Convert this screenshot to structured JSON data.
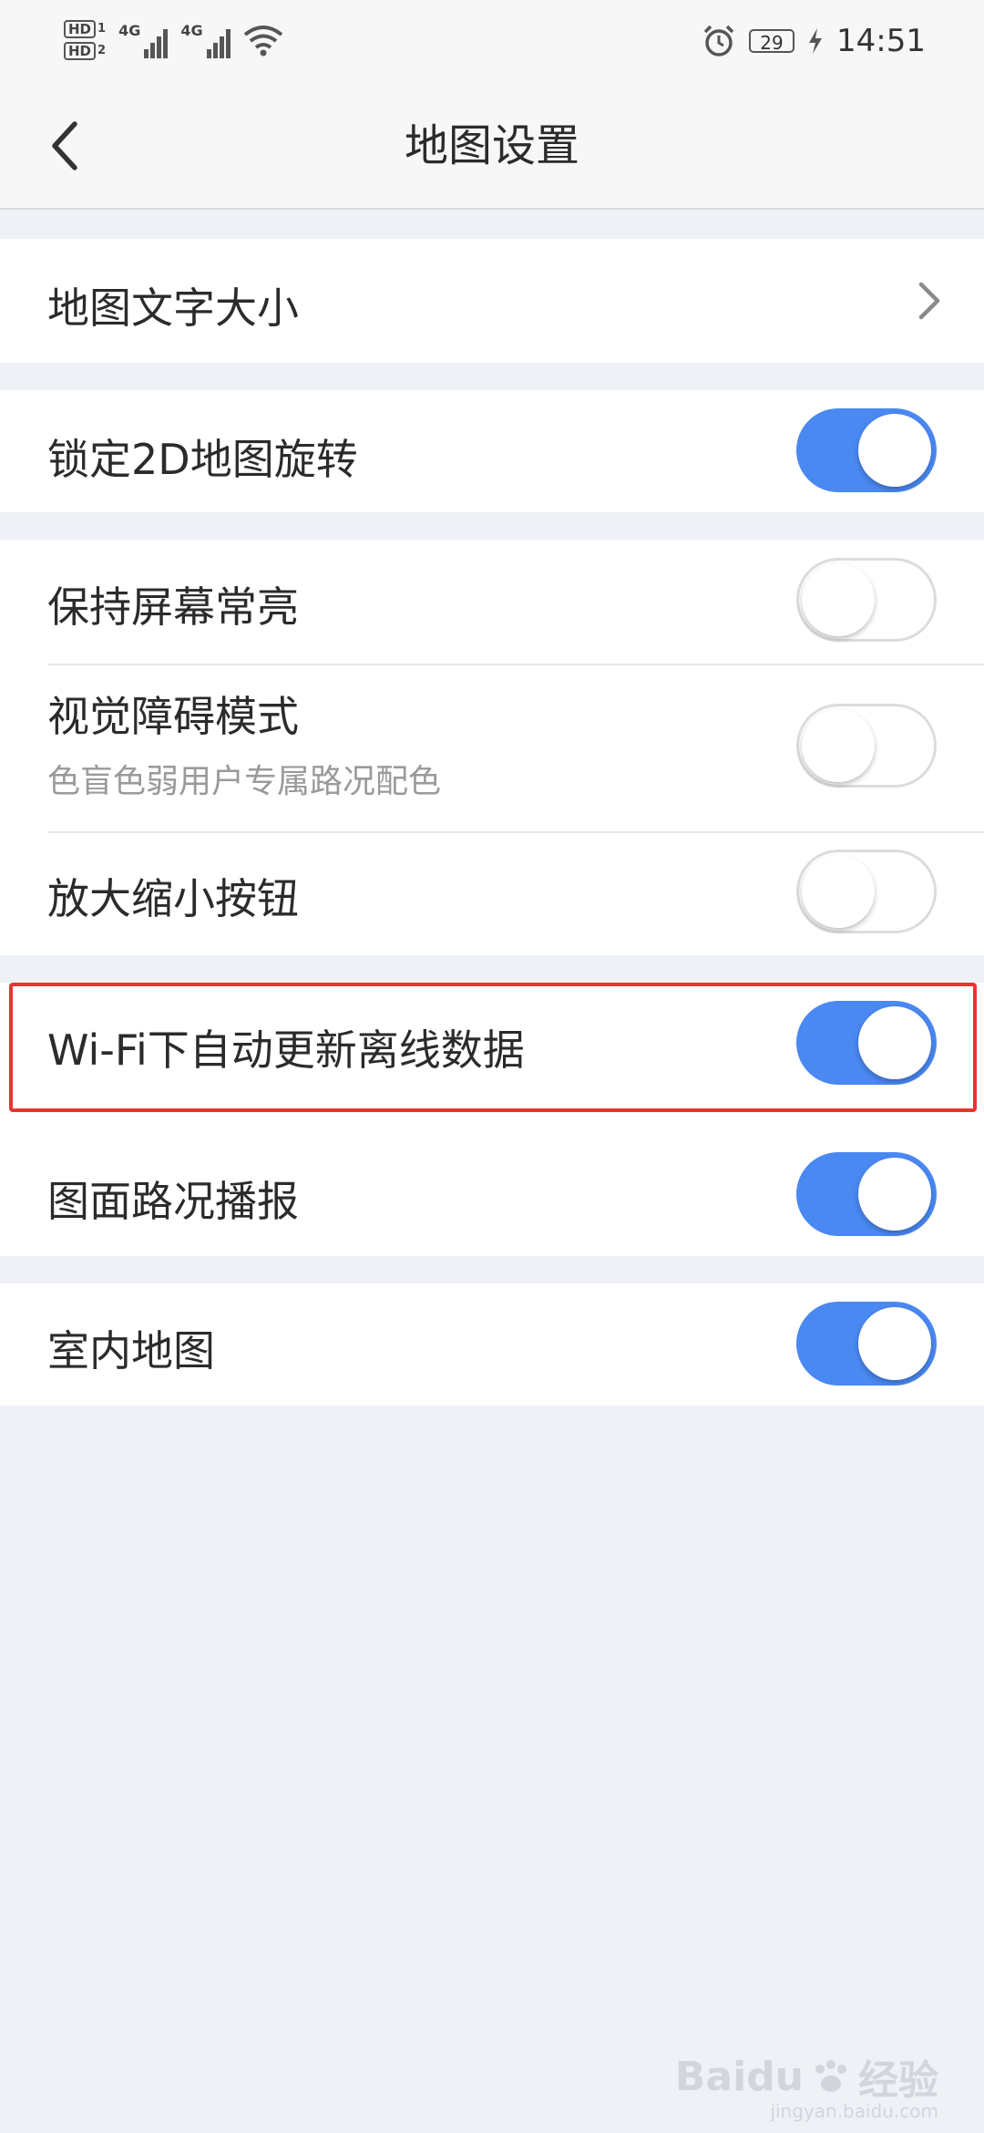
{
  "status_bar": {
    "sim1_label": "HD",
    "sim1_index": "1",
    "sim2_label": "HD",
    "sim2_index": "2",
    "network1": "4G",
    "network2": "4G",
    "battery_level": "29",
    "time": "14:51",
    "icons": [
      "signal-icon",
      "wifi-icon",
      "alarm-icon",
      "battery-icon",
      "charging-icon"
    ]
  },
  "header": {
    "title": "地图设置",
    "back_icon": "chevron-left-icon"
  },
  "settings": {
    "map_text_size": {
      "label": "地图文字大小"
    },
    "lock_2d_rotation": {
      "label": "锁定2D地图旋转",
      "enabled": true
    },
    "keep_screen_on": {
      "label": "保持屏幕常亮",
      "enabled": false
    },
    "visual_impairment_mode": {
      "label": "视觉障碍模式",
      "description": "色盲色弱用户专属路况配色",
      "enabled": false
    },
    "zoom_buttons": {
      "label": "放大缩小按钮",
      "enabled": false
    },
    "wifi_auto_update": {
      "label": "Wi-Fi下自动更新离线数据",
      "enabled": true
    },
    "traffic_broadcast": {
      "label": "图面路况播报",
      "enabled": true
    },
    "indoor_map": {
      "label": "室内地图",
      "enabled": true
    }
  },
  "colors": {
    "toggle_on": "#4a88f2",
    "highlight": "#e8342f",
    "background": "#eef1f5"
  },
  "watermark": {
    "brand": "Baidu",
    "suffix": "经验",
    "site": "jingyan.baidu.com"
  }
}
